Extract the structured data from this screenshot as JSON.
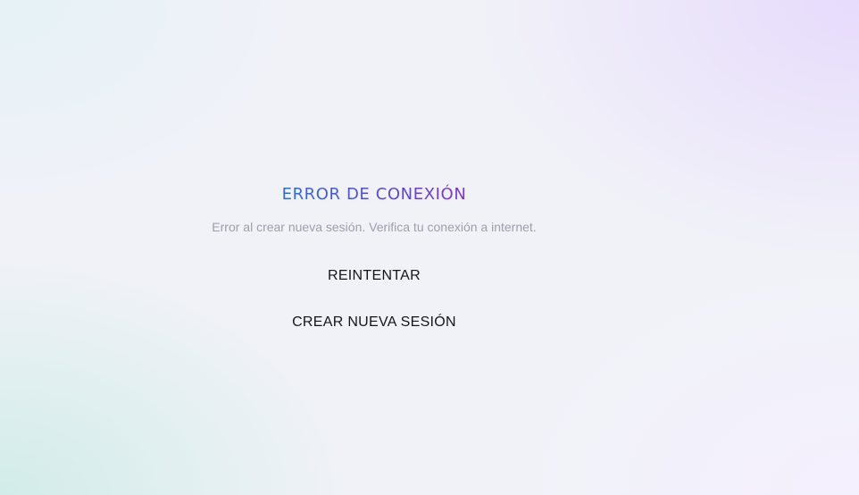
{
  "error": {
    "title": "ERROR DE CONEXIÓN",
    "message": "Error al crear nueva sesión. Verifica tu conexión a internet.",
    "title_gradient": [
      "#2f6bdb",
      "#7b35dc"
    ]
  },
  "actions": {
    "retry_label": "REINTENTAR",
    "new_session_label": "CREAR NUEVA SESIÓN"
  }
}
